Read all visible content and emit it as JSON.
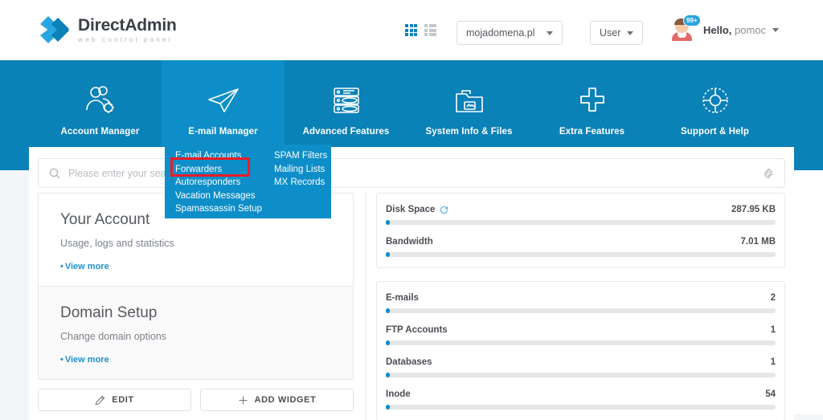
{
  "brand": {
    "title_bold": "Direct",
    "title_rest": "Admin",
    "subtitle": "web control panel",
    "logo_icon": "chevron-double-right-logo",
    "accent": "#0a81b7",
    "accent_light": "#0d8ec8",
    "highlight": "#ee1b24"
  },
  "header": {
    "grid_view_icon": "grid-view-icon",
    "list_view_icon": "list-view-icon",
    "domain_selector": {
      "value": "mojadomena.pl",
      "icon": "chevron-down-icon"
    },
    "user_selector": {
      "value": "User",
      "icon": "chevron-down-icon"
    },
    "account": {
      "avatar_icon": "user-avatar",
      "badge": "99+",
      "greeting": "Hello,",
      "username": "pomoc",
      "icon": "chevron-down-icon"
    }
  },
  "nav": {
    "items": [
      {
        "label": "Account Manager",
        "icon": "users-gear-icon",
        "active": false
      },
      {
        "label": "E-mail Manager",
        "icon": "paper-plane-icon",
        "active": true
      },
      {
        "label": "Advanced Features",
        "icon": "database-stack-icon",
        "active": false
      },
      {
        "label": "System Info & Files",
        "icon": "folder-files-icon",
        "active": false
      },
      {
        "label": "Extra Features",
        "icon": "plus-icon",
        "active": false
      },
      {
        "label": "Support & Help",
        "icon": "lifebuoy-icon",
        "active": false
      }
    ]
  },
  "dropdown": {
    "column_1": [
      "E-mail Accounts",
      "Forwarders",
      "Autoresponders",
      "Vacation Messages",
      "Spamassassin Setup"
    ],
    "column_2": [
      "SPAM Filters",
      "Mailing Lists",
      "MX Records"
    ],
    "highlighted_item": "Forwarders"
  },
  "search": {
    "placeholder": "Please enter your search criteria",
    "value": "",
    "search_icon": "search-icon",
    "settings_icon": "gear-icon"
  },
  "widgets": [
    {
      "title": "Your Account",
      "subtitle": "Usage, logs and statistics",
      "link": "View more"
    },
    {
      "title": "Domain Setup",
      "subtitle": "Change domain options",
      "link": "View more"
    }
  ],
  "widget_buttons": [
    {
      "label": "EDIT",
      "icon": "pencil-icon"
    },
    {
      "label": "ADD WIDGET",
      "icon": "plus-icon"
    }
  ],
  "stat_cards": [
    {
      "rows": [
        {
          "label": "Disk Space",
          "value": "287.95 KB",
          "icon": "refresh-icon",
          "percent": 1
        },
        {
          "label": "Bandwidth",
          "value": "7.01 MB",
          "icon": "",
          "percent": 1
        }
      ]
    },
    {
      "rows": [
        {
          "label": "E-mails",
          "value": "2",
          "icon": "",
          "percent": 1
        },
        {
          "label": "FTP Accounts",
          "value": "1",
          "icon": "",
          "percent": 1
        },
        {
          "label": "Databases",
          "value": "1",
          "icon": "",
          "percent": 1
        },
        {
          "label": "Inode",
          "value": "54",
          "icon": "",
          "percent": 1
        }
      ]
    }
  ]
}
